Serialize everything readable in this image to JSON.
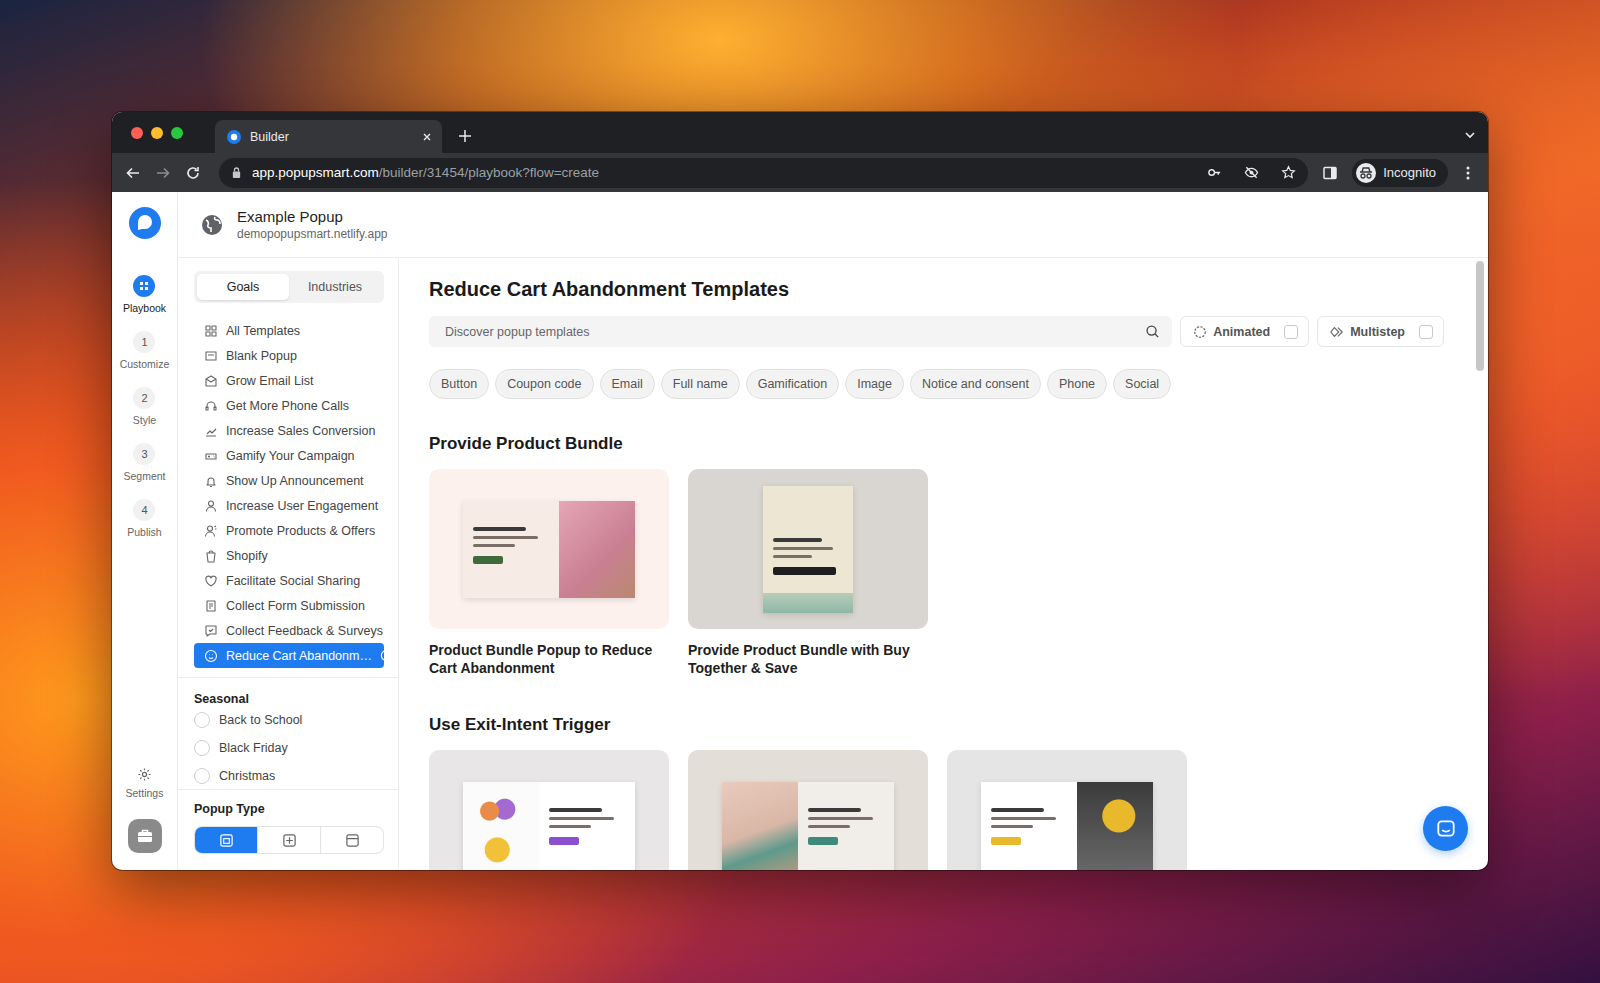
{
  "browser": {
    "tabs": [
      {
        "label": "Builder",
        "selected": true
      }
    ],
    "url": {
      "host": "app.popupsmart.com",
      "path": "/builder/31454/playbook?flow=create"
    },
    "profile": "Incognito"
  },
  "rail": {
    "items": [
      {
        "label": "Playbook",
        "selected": true
      },
      {
        "step": "1",
        "label": "Customize",
        "selected": false
      },
      {
        "step": "2",
        "label": "Style",
        "selected": false
      },
      {
        "step": "3",
        "label": "Segment",
        "selected": false
      },
      {
        "step": "4",
        "label": "Publish",
        "selected": false
      }
    ],
    "settings": "Settings"
  },
  "header": {
    "title": "Example Popup",
    "site": "demopopupsmart.netlify.app"
  },
  "sidebar": {
    "tabs": [
      {
        "label": "Goals",
        "selected": true
      },
      {
        "label": "Industries",
        "selected": false
      }
    ],
    "goals": [
      {
        "label": "All Templates",
        "selected": false
      },
      {
        "label": "Blank Popup",
        "selected": false
      },
      {
        "label": "Grow Email List",
        "selected": false
      },
      {
        "label": "Get More Phone Calls",
        "selected": false
      },
      {
        "label": "Increase Sales Conversion",
        "selected": false
      },
      {
        "label": "Gamify Your Campaign",
        "selected": false
      },
      {
        "label": "Show Up Announcement",
        "selected": false
      },
      {
        "label": "Increase User Engagement",
        "selected": false
      },
      {
        "label": "Promote Products & Offers",
        "selected": false
      },
      {
        "label": "Shopify",
        "selected": false
      },
      {
        "label": "Facilitate Social Sharing",
        "selected": false
      },
      {
        "label": "Collect Form Submission",
        "selected": false
      },
      {
        "label": "Collect Feedback & Surveys",
        "selected": false
      },
      {
        "label": "Reduce Cart Abandonm…",
        "selected": true
      }
    ],
    "seasonal": {
      "title": "Seasonal",
      "items": [
        {
          "label": "Back to School",
          "checked": false
        },
        {
          "label": "Black Friday",
          "checked": false
        },
        {
          "label": "Christmas",
          "checked": false
        }
      ]
    },
    "popup_type": {
      "title": "Popup Type",
      "options": [
        {
          "kind": "modal",
          "selected": true
        },
        {
          "kind": "floating",
          "selected": false
        },
        {
          "kind": "bar",
          "selected": false
        }
      ]
    }
  },
  "main": {
    "title": "Reduce Cart Abandonment Templates",
    "search": {
      "placeholder": "Discover popup templates"
    },
    "toggles": [
      {
        "label": "Animated",
        "kind": "animated",
        "checked": false
      },
      {
        "label": "Multistep",
        "kind": "multistep",
        "checked": false
      }
    ],
    "chips": [
      {
        "label": "Button",
        "selected": false
      },
      {
        "label": "Coupon code",
        "selected": false
      },
      {
        "label": "Email",
        "selected": false
      },
      {
        "label": "Full name",
        "selected": false
      },
      {
        "label": "Gamification",
        "selected": false
      },
      {
        "label": "Image",
        "selected": false
      },
      {
        "label": "Notice and consent",
        "selected": false
      },
      {
        "label": "Phone",
        "selected": false
      },
      {
        "label": "Social",
        "selected": false
      }
    ],
    "sections": [
      {
        "title": "Provide Product Bundle",
        "cards": [
          {
            "title": "Product Bundle Popup to Reduce Cart Abandonment",
            "kind": "bundle-split"
          },
          {
            "title": "Provide Product Bundle with Buy Together & Save",
            "kind": "bundle-portrait"
          }
        ]
      },
      {
        "title": "Use Exit-Intent Trigger",
        "cards": [
          {
            "kind": "exit-illustration"
          },
          {
            "kind": "exit-photo-left"
          },
          {
            "kind": "exit-photo-right"
          }
        ]
      }
    ]
  }
}
